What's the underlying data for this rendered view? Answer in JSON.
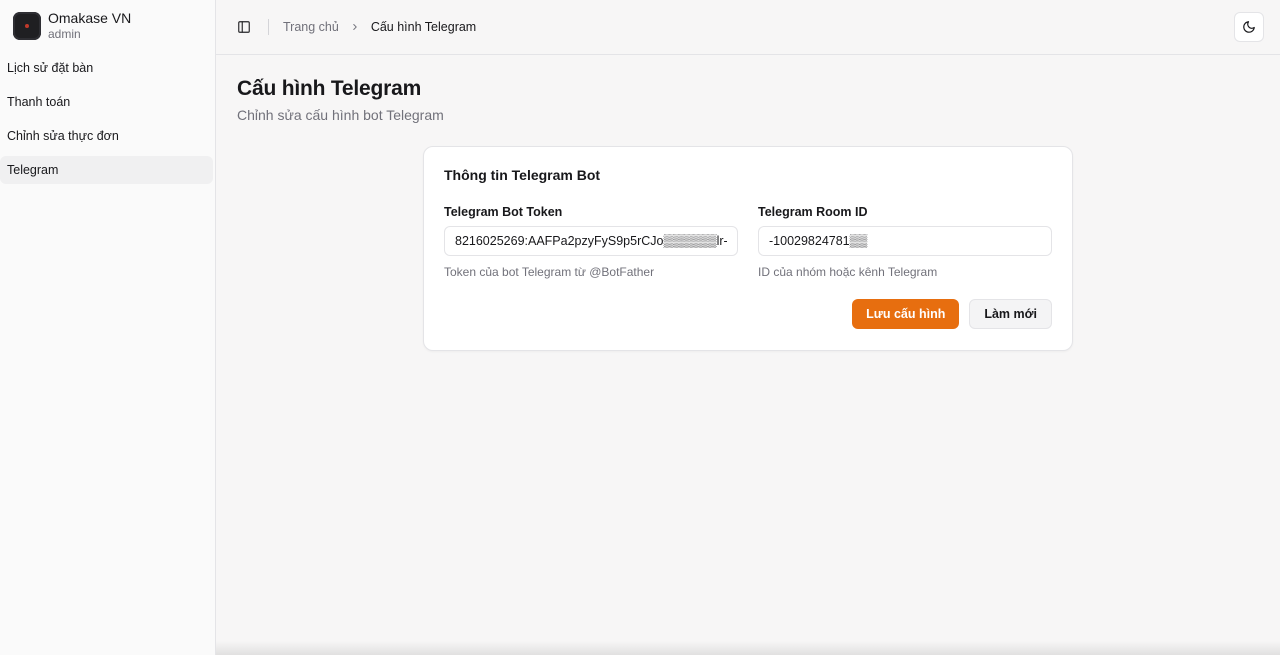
{
  "brand": {
    "name": "Omakase VN",
    "role": "admin"
  },
  "sidebar": {
    "items": [
      {
        "label": "Lịch sử đặt bàn"
      },
      {
        "label": "Thanh toán"
      },
      {
        "label": "Chỉnh sửa thực đơn"
      },
      {
        "label": "Telegram"
      }
    ]
  },
  "breadcrumb": {
    "home": "Trang chủ",
    "current": "Cấu hình Telegram"
  },
  "page": {
    "title": "Cấu hình Telegram",
    "subtitle": "Chỉnh sửa cấu hình bot Telegram"
  },
  "card": {
    "title": "Thông tin Telegram Bot",
    "token": {
      "label": "Telegram Bot Token",
      "value": "8216025269:AAFPa2pzyFyS9p5rCJo▒▒▒▒▒▒lr-",
      "hint": "Token của bot Telegram từ @BotFather"
    },
    "room": {
      "label": "Telegram Room ID",
      "value": "-10029824781▒▒",
      "hint": "ID của nhóm hoặc kênh Telegram"
    },
    "save_label": "Lưu cấu hình",
    "reset_label": "Làm mới"
  },
  "colors": {
    "accent": "#e76e0f",
    "border": "#e4e4e7",
    "muted_text": "#71717a"
  },
  "icons": {
    "sidebar_toggle": "panel-left-icon",
    "breadcrumb_separator": "chevron-right-icon",
    "theme_toggle": "moon-icon"
  }
}
